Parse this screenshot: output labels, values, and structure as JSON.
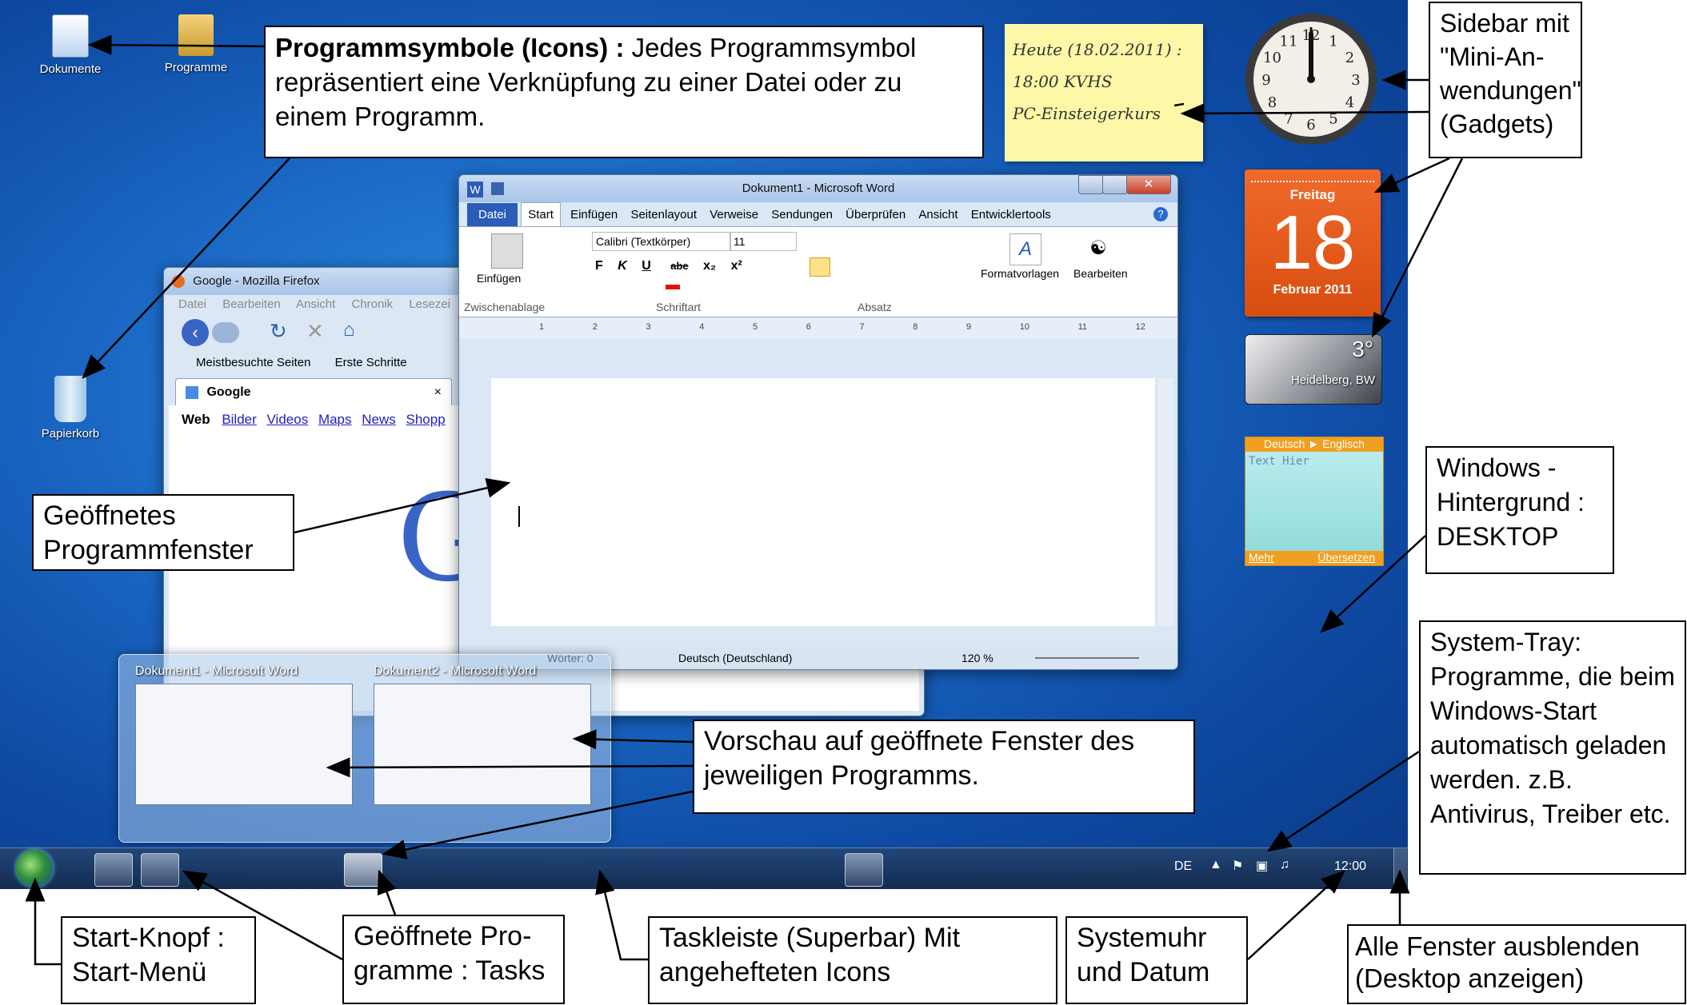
{
  "desktop_icons": [
    {
      "label": "Dokumente"
    },
    {
      "label": "Programme"
    },
    {
      "label": "Papierkorb"
    }
  ],
  "sticky": {
    "line1": "Heute (18.02.2011) :",
    "line2": "18:00 KVHS",
    "line3": "PC-Einsteigerkurs"
  },
  "calendar": {
    "weekday": "Freitag",
    "day": "18",
    "month": "Februar 2011"
  },
  "weather": {
    "temp": "3°",
    "city": "Heidelberg, BW"
  },
  "translator": {
    "from": "Deutsch",
    "arrow": "►",
    "to": "Englisch",
    "placeholder": "Text Hier",
    "more": "Mehr",
    "translate": "Übersetzen"
  },
  "clock": {
    "numbers": [
      "12",
      "1",
      "2",
      "3",
      "4",
      "5",
      "6",
      "7",
      "8",
      "9",
      "10",
      "11"
    ]
  },
  "firefox": {
    "title": "Google - Mozilla Firefox",
    "menu": [
      "Datei",
      "Bearbeiten",
      "Ansicht",
      "Chronik",
      "Lesezei"
    ],
    "bookmarks": [
      "Meistbesuchte Seiten",
      "Erste Schritte"
    ],
    "tab": "Google",
    "tab_close": "×",
    "links": [
      "Web",
      "Bilder",
      "Videos",
      "Maps",
      "News",
      "Shopp"
    ],
    "logo_letter": "G"
  },
  "word": {
    "title": "Dokument1 - Microsoft Word",
    "tabs": [
      "Datei",
      "Start",
      "Einfügen",
      "Seitenlayout",
      "Verweise",
      "Sendungen",
      "Überprüfen",
      "Ansicht",
      "Entwicklertools"
    ],
    "font": "Calibri (Textkörper)",
    "size": "11",
    "groups": [
      "Zwischenablage",
      "Schriftart",
      "Absatz"
    ],
    "paste": "Einfügen",
    "styles": "Formatvorlagen",
    "edit": "Bearbeiten",
    "format_glyphs": [
      "F",
      "K",
      "U",
      "abe",
      "x₂",
      "x²"
    ],
    "status_words": "Wörter: 0",
    "status_lang": "Deutsch (Deutschland)",
    "zoom": "120 %",
    "ruler": [
      "1",
      "2",
      "3",
      "4",
      "5",
      "6",
      "7",
      "8",
      "9",
      "10",
      "11",
      "12"
    ]
  },
  "previews": [
    {
      "title": "Dokument1 - Microsoft Word"
    },
    {
      "title": "Dokument2 - Microsoft Word"
    }
  ],
  "tray": {
    "lang": "DE",
    "time": "12:00"
  },
  "callouts": {
    "icons_bold": "Programmsymbole (Icons) :",
    "icons_text": " Jedes Programmsymbol repräsentiert eine Verknüpfung zu einer Datei oder zu einem Programm.",
    "sidebar": "Sidebar mit \"Mini-An-wendungen\" (Gadgets)",
    "window": "Geöffnetes Programmfenster",
    "background": "Windows - Hintergrund : DESKTOP",
    "systray": "System-Tray: Programme, die beim Windows-Start automatisch geladen werden. z.B. Antivirus, Treiber etc.",
    "preview": "Vorschau auf geöffnete Fenster des jeweiligen Programms.",
    "start": "Start-Knopf : Start-Menü",
    "tasks": "Geöffnete Pro-gramme : Tasks",
    "taskbar": "Taskleiste (Superbar) Mit angehefteten Icons",
    "clock": "Systemuhr und Datum",
    "showdesktop": "Alle Fenster ausblenden (Desktop anzeigen)"
  },
  "colors": {
    "desktop": "#1c6cc8",
    "calendar": "#e8561c",
    "sticky": "#fdf8a8"
  }
}
